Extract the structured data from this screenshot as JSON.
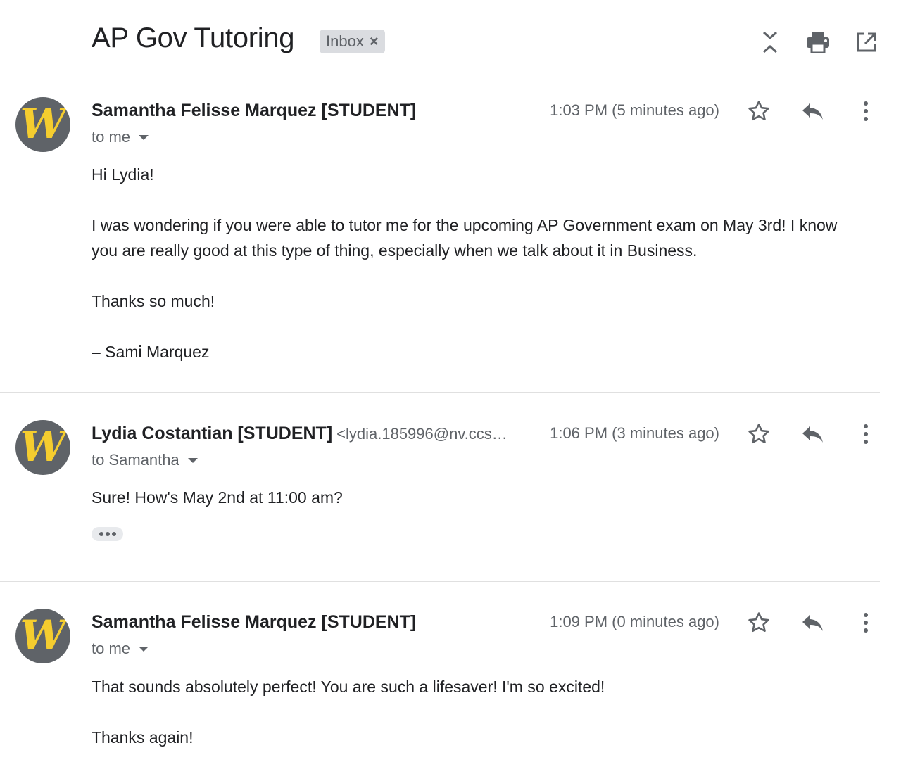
{
  "thread": {
    "subject": "AP Gov Tutoring",
    "label": "Inbox",
    "label_remove": "×"
  },
  "header_icons": [
    "collapse-all-icon",
    "print-icon",
    "open-new-window-icon"
  ],
  "colors": {
    "avatar_bg": "#5f6368",
    "avatar_letter": "#f5cd2f",
    "muted_text": "#5f6368",
    "chip_bg": "#dadce0"
  },
  "messages": [
    {
      "sender": "Samantha Felisse Marquez [STUDENT]",
      "sender_email": "",
      "recipient": "to me",
      "time": "1:03 PM (5 minutes ago)",
      "avatar_letter": "W",
      "body": [
        "Hi Lydia!",
        "I was wondering if you were able to tutor me for the upcoming AP Government exam on May 3rd! I know you are really good at this type of thing, especially when we talk about it in Business.",
        "Thanks so much!",
        "– Sami Marquez"
      ]
    },
    {
      "sender": "Lydia Costantian [STUDENT]",
      "sender_email": "<lydia.185996@nv.ccs…",
      "recipient": "to Samantha",
      "time": "1:06 PM (3 minutes ago)",
      "avatar_letter": "W",
      "body": [
        "Sure! How's May 2nd at 11:00 am?"
      ]
    },
    {
      "sender": "Samantha Felisse Marquez [STUDENT]",
      "sender_email": "",
      "recipient": "to me",
      "time": "1:09 PM (0 minutes ago)",
      "avatar_letter": "W",
      "body": [
        "That sounds absolutely perfect! You are such a lifesaver! I'm so excited!",
        "Thanks again!"
      ]
    }
  ]
}
